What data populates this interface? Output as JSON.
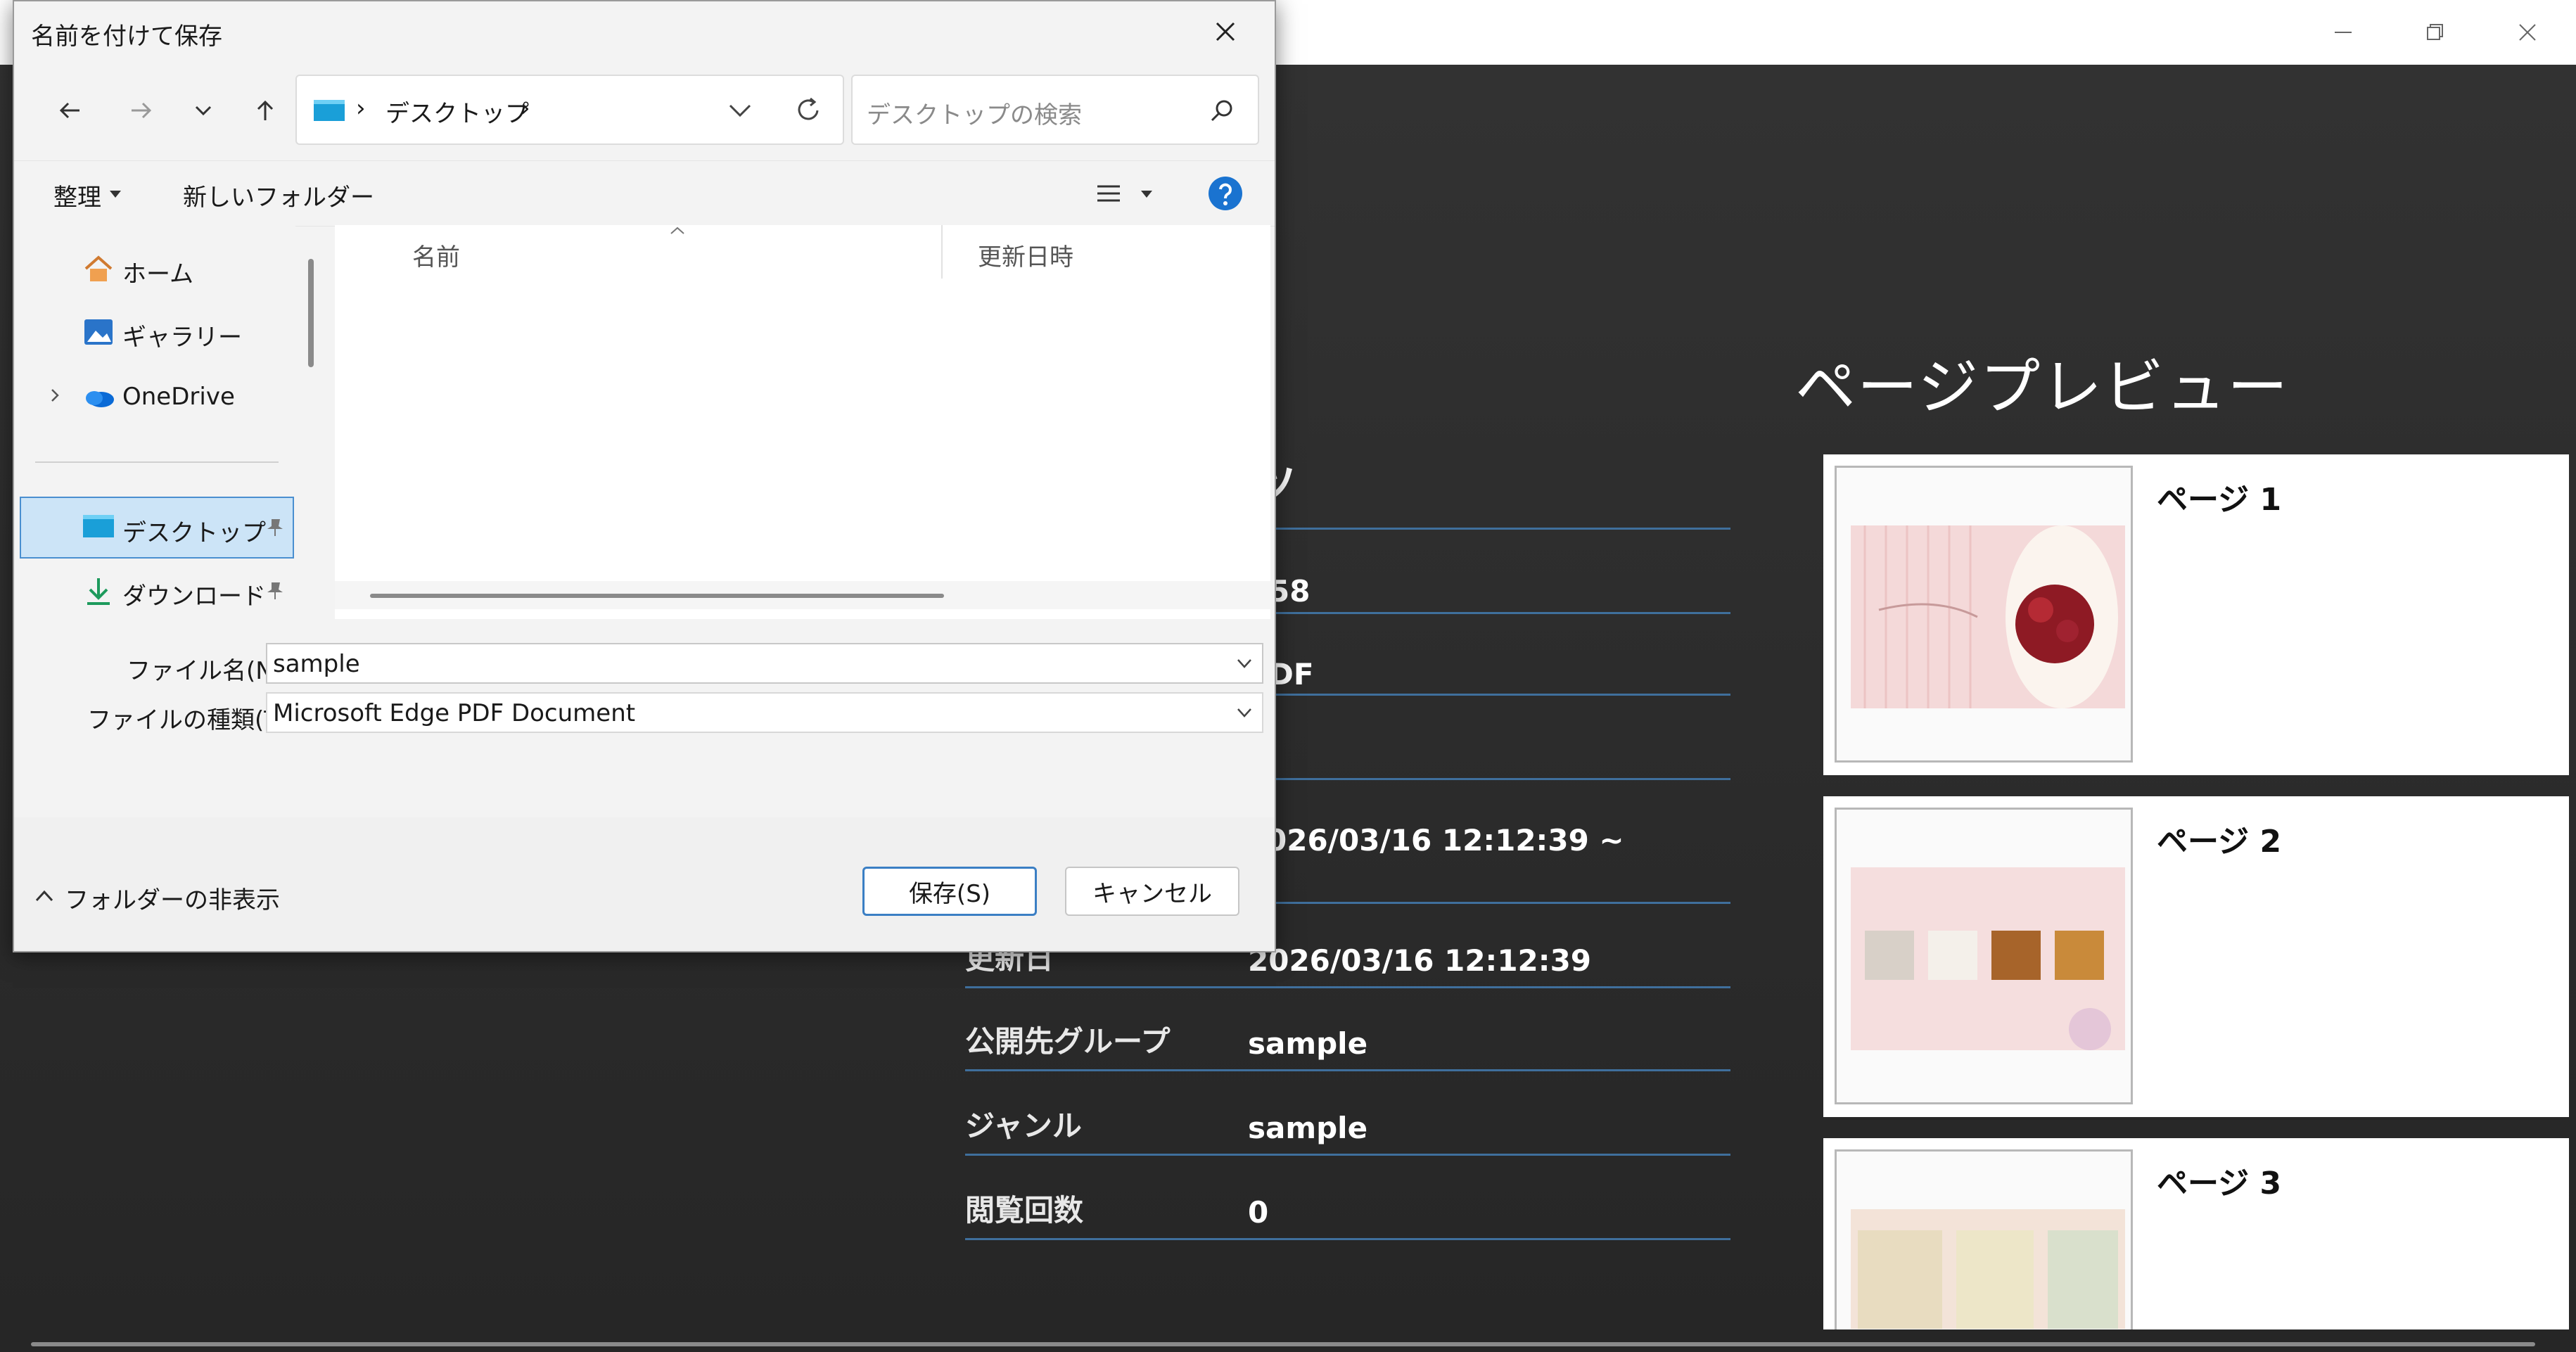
{
  "background_app": {
    "preview_title": "ページプレビュー",
    "partial_heading": "ツ",
    "partial_values": [
      "58",
      "DF",
      "026/03/16 12:12:39 ~"
    ],
    "details": [
      {
        "label": "更新日",
        "value": "2026/03/16 12:12:39"
      },
      {
        "label": "公開先グループ",
        "value": "sample"
      },
      {
        "label": "ジャンル",
        "value": "sample"
      },
      {
        "label": "閲覧回数",
        "value": "0"
      }
    ],
    "pages": [
      {
        "label": "ページ 1"
      },
      {
        "label": "ページ 2"
      },
      {
        "label": "ページ 3"
      }
    ]
  },
  "dialog": {
    "title": "名前を付けて保存",
    "address": {
      "separator": "›",
      "location": "デスクトップ",
      "trail": "›"
    },
    "search_placeholder": "デスクトップの検索",
    "toolbar": {
      "organize": "整理",
      "new_folder": "新しいフォルダー"
    },
    "nav": {
      "home": "ホーム",
      "gallery": "ギャラリー",
      "onedrive": "OneDrive",
      "desktop": "デスクトップ",
      "downloads": "ダウンロード"
    },
    "columns": {
      "name": "名前",
      "modified": "更新日時"
    },
    "filename_label": "ファイル名(N):",
    "filename_value": "sample",
    "filetype_label": "ファイルの種類(T):",
    "filetype_value": "Microsoft Edge PDF Document",
    "save_button": "保存(S)",
    "cancel_button": "キャンセル",
    "hide_folders": "フォルダーの非表示"
  }
}
